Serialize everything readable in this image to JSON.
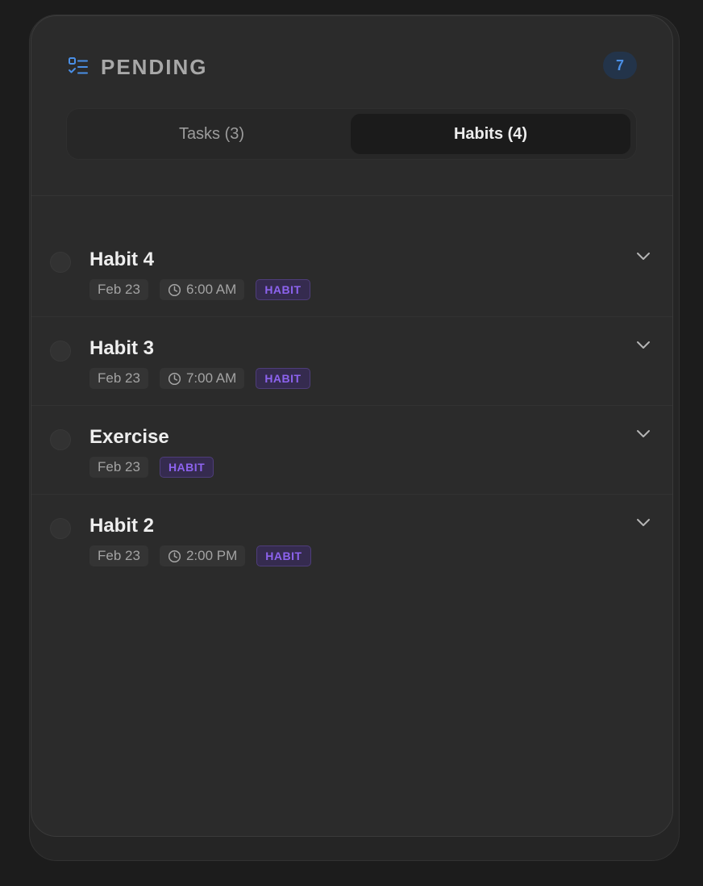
{
  "header": {
    "title": "PENDING",
    "count": "7",
    "icon": "checklist-icon"
  },
  "tabs": [
    {
      "label": "Tasks (3)",
      "active": false
    },
    {
      "label": "Habits (4)",
      "active": true
    }
  ],
  "items": [
    {
      "title": "Habit 4",
      "date": "Feb 23",
      "time": "6:00 AM",
      "badge": "HABIT"
    },
    {
      "title": "Habit 3",
      "date": "Feb 23",
      "time": "7:00 AM",
      "badge": "HABIT"
    },
    {
      "title": "Exercise",
      "date": "Feb 23",
      "badge": "HABIT"
    },
    {
      "title": "Habit 2",
      "date": "Feb 23",
      "time": "2:00 PM",
      "badge": "HABIT"
    }
  ],
  "colors": {
    "accent": "#4a8fe6",
    "habit_badge": "#8d63ef",
    "background": "#2b2b2b"
  }
}
